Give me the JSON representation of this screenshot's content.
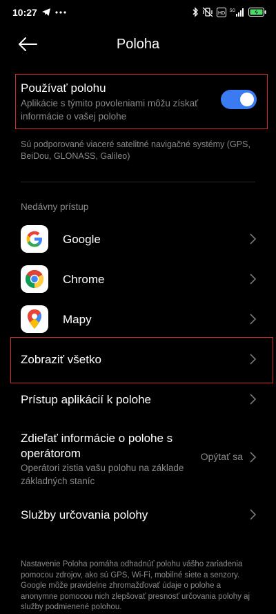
{
  "status_bar": {
    "time": "10:27",
    "left_icons": [
      "telegram-icon",
      "more-dots-icon"
    ],
    "right_icons": [
      "bluetooth-icon",
      "vibrate-off-icon",
      "volte-icon",
      "5g-signal-icon",
      "battery-icon"
    ],
    "network": "5G"
  },
  "header": {
    "title": "Poloha",
    "back_icon": "arrow-left-icon"
  },
  "use_location": {
    "title": "Používať polohu",
    "description": "Aplikácie s týmito povoleniami môžu získať informácie o vašej polohe",
    "enabled": true
  },
  "gnss_note": "Sú podporované viaceré satelitné navigačné systémy (GPS, BeiDou, GLONASS, Galileo)",
  "recent": {
    "section_label": "Nedávny prístup",
    "apps": [
      {
        "name": "Google",
        "icon": "google-icon"
      },
      {
        "name": "Chrome",
        "icon": "chrome-icon"
      },
      {
        "name": "Mapy",
        "icon": "maps-icon"
      }
    ],
    "show_all": "Zobraziť všetko"
  },
  "menu": {
    "app_access": "Prístup aplikácií k polohe",
    "share_operator": {
      "title": "Zdieľať informácie o polohe s operátorom",
      "subtitle": "Operátori zistia vašu polohu na základe základných staníc",
      "value": "Opýtať sa"
    },
    "location_services": "Služby určovania polohy"
  },
  "footer": "Nastavenie Poloha pomáha odhadnúť polohu vášho zariadenia pomocou zdrojov, ako sú GPS, Wi-Fi, mobilné siete a senzory. Google môže pravidelne zhromažďovať údaje o polohe a anonymne pomocou nich zlepšovať presnosť určovania polohy aj služby podmienené polohou.",
  "colors": {
    "background": "#000000",
    "accent": "#3a7bf2",
    "highlight": "#d42a2a",
    "secondary_text": "#8a8a8a"
  }
}
